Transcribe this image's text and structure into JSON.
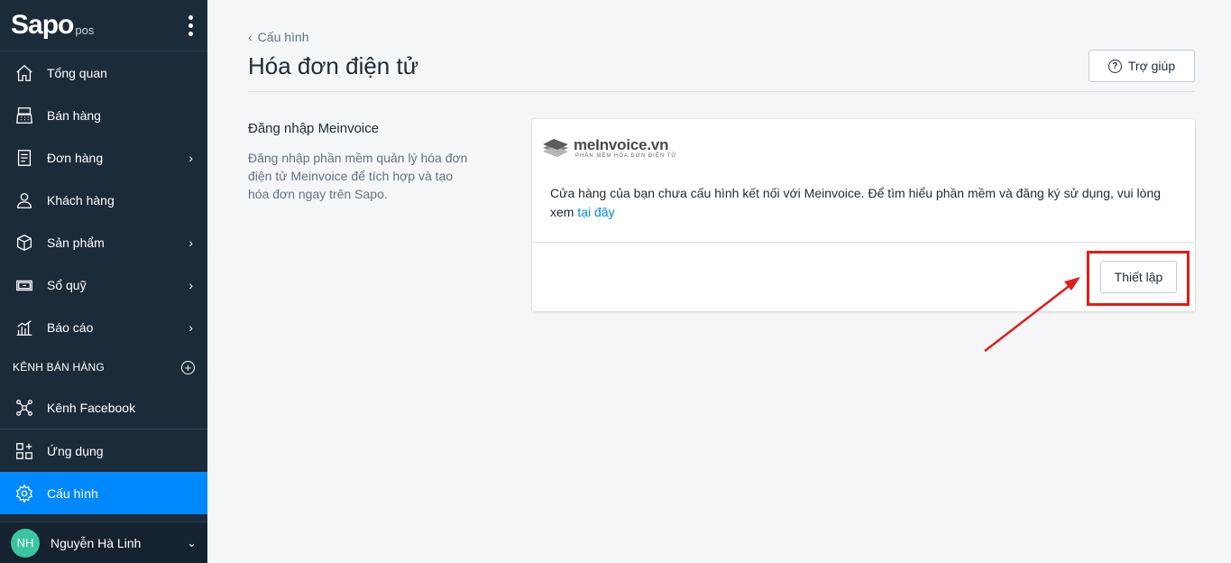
{
  "sidebar": {
    "logo_main": "Sapo",
    "logo_sub": "pos",
    "items": [
      {
        "label": "Tổng quan"
      },
      {
        "label": "Bán hàng"
      },
      {
        "label": "Đơn hàng"
      },
      {
        "label": "Khách hàng"
      },
      {
        "label": "Sản phẩm"
      },
      {
        "label": "Sổ quỹ"
      },
      {
        "label": "Báo cáo"
      }
    ],
    "channels_heading": "KÊNH BÁN HÀNG",
    "channel_items": [
      {
        "label": "Kênh Facebook"
      }
    ],
    "apps_label": "Ứng dụng",
    "settings_label": "Cấu hình",
    "user": {
      "initials": "NH",
      "name": "Nguyễn Hà Linh"
    }
  },
  "header": {
    "breadcrumb": "Cấu hình",
    "title": "Hóa đơn điện tử",
    "help_label": "Trợ giúp"
  },
  "section": {
    "title": "Đăng nhập Meinvoice",
    "description": "Đăng nhập phần mềm quản lý hóa đơn điện tử Meinvoice để tích hợp và tạo hóa đơn ngay trên Sapo."
  },
  "card": {
    "brand_name": "meInvoice.vn",
    "brand_tagline": "PHẦN MỀM HÓA ĐƠN ĐIỆN TỬ",
    "message": "Cửa hàng của bạn chưa cấu hình kết nối với Meinvoice. Để tìm hiểu phần mềm và đăng ký sử dụng, vui lòng xem",
    "link_label": "tại đây",
    "setup_label": "Thiết lập"
  },
  "colors": {
    "sidebar_bg": "#1c2b3a",
    "active_bg": "#0088ff",
    "link": "#0088ff",
    "highlight": "#e31b1b"
  }
}
